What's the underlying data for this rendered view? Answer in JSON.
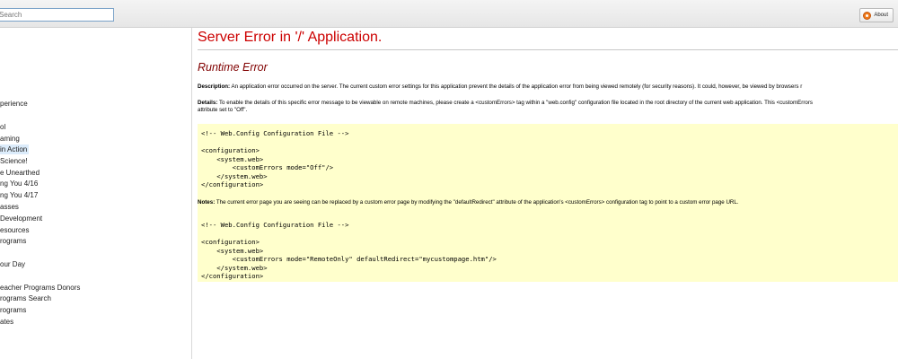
{
  "search": {
    "placeholder": "Search"
  },
  "header": {
    "about_label": "About"
  },
  "sidebar": {
    "items": [
      {
        "label": "perience"
      },
      {
        "label": "ol"
      },
      {
        "label": "aming"
      },
      {
        "label": "in Action"
      },
      {
        "label": "Science!"
      },
      {
        "label": "e Unearthed"
      },
      {
        "label": "ng You 4/16"
      },
      {
        "label": "ng You 4/17"
      },
      {
        "label": "asses"
      },
      {
        "label": "Development"
      },
      {
        "label": "esources"
      },
      {
        "label": "rograms"
      },
      {
        "label": "our Day"
      },
      {
        "label": "eacher Programs Donors"
      },
      {
        "label": "rograms Search"
      },
      {
        "label": "rograms"
      },
      {
        "label": "ates"
      }
    ]
  },
  "error": {
    "title": "Server Error in '/' Application.",
    "subtitle": "Runtime Error",
    "description_label": "Description:",
    "description_text": " An application error occurred on the server. The current custom error settings for this application prevent the details of the application error from being viewed remotely (for security reasons). It could, however, be viewed by browsers r",
    "details_label": "Details:",
    "details_text": " To enable the details of this specific error message to be viewable on remote machines, please create a <customErrors> tag within a \"web.config\" configuration file located in the root directory of the current web application. This <customErrors",
    "details_text_2": "attribute set to \"Off\".",
    "code1": "<!-- Web.Config Configuration File -->\n\n<configuration>\n    <system.web>\n        <customErrors mode=\"Off\"/>\n    </system.web>\n</configuration>",
    "notes_label": "Notes:",
    "notes_text": " The current error page you are seeing can be replaced by a custom error page by modifying the \"defaultRedirect\" attribute of the application's <customErrors> configuration tag to point to a custom error page URL.",
    "code2": "<!-- Web.Config Configuration File -->\n\n<configuration>\n    <system.web>\n        <customErrors mode=\"RemoteOnly\" defaultRedirect=\"mycustompage.htm\"/>\n    </system.web>\n</configuration>"
  }
}
